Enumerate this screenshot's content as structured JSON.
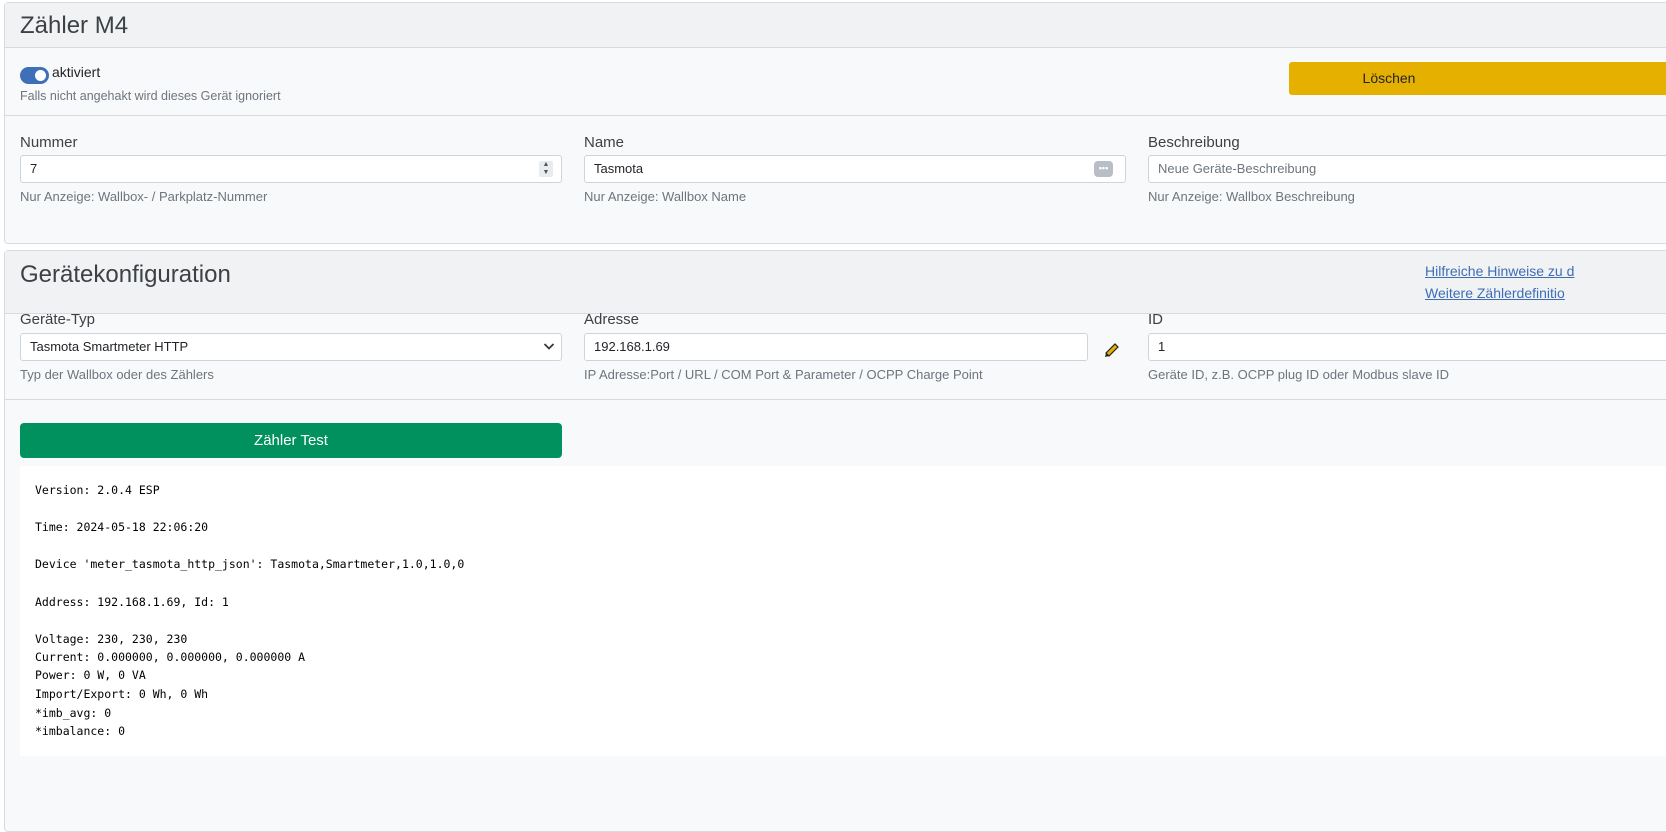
{
  "meter_card": {
    "title": "Zähler M4",
    "enabled_label": "aktiviert",
    "enabled_help": "Falls nicht angehakt wird dieses Gerät ignoriert",
    "enabled": true,
    "delete_label": "Löschen",
    "fields": {
      "number": {
        "label": "Nummer",
        "value": "7",
        "help": "Nur Anzeige: Wallbox- / Parkplatz-Nummer"
      },
      "name": {
        "label": "Name",
        "value": "Tasmota",
        "help": "Nur Anzeige: Wallbox Name"
      },
      "description": {
        "label": "Beschreibung",
        "placeholder": "Neue Geräte-Beschreibung",
        "help": "Nur Anzeige: Wallbox Beschreibung"
      }
    }
  },
  "config_card": {
    "title": "Gerätekonfiguration",
    "links": [
      "Hilfreiche Hinweise zu d",
      "Weitere Zählerdefinitio"
    ],
    "fields": {
      "type": {
        "label": "Geräte-Typ",
        "value": "Tasmota Smartmeter HTTP",
        "help": "Typ der Wallbox oder des Zählers"
      },
      "address": {
        "label": "Adresse",
        "value": "192.168.1.69",
        "help": "IP Adresse:Port / URL / COM Port & Parameter / OCPP Charge Point"
      },
      "id": {
        "label": "ID",
        "value": "1",
        "help": "Geräte ID, z.B. OCPP plug ID oder Modbus slave ID"
      }
    },
    "test_button": "Zähler Test",
    "console_lines": [
      "Version: 2.0.4 ESP",
      "Time: 2024-05-18 22:06:20",
      "Device 'meter_tasmota_http_json': Tasmota,Smartmeter,1.0,1.0,0",
      "Address: 192.168.1.69, Id: 1",
      "Voltage: 230, 230, 230",
      "Current: 0.000000, 0.000000, 0.000000 A",
      "Power: 0 W, 0 VA",
      "Import/Export: 0 Wh, 0 Wh",
      "*imb_avg: 0",
      "*imbalance: 0"
    ]
  },
  "colors": {
    "accent": "#3f6fb9",
    "delete": "#e6b000",
    "test": "#00915f",
    "link": "#3d6eb5"
  }
}
